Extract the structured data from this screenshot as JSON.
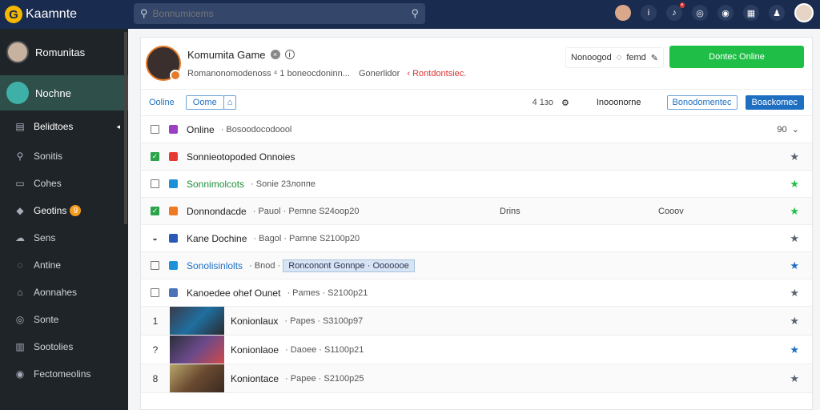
{
  "app": {
    "logo_letter": "G",
    "name": "Kaamnte"
  },
  "search": {
    "placeholder": "Bonnumicems"
  },
  "top_icons": [
    "user-avatar",
    "info-icon",
    "notification-icon",
    "globe-icon",
    "discord-icon",
    "calendar-icon",
    "person-icon",
    "profile-avatar"
  ],
  "sidebar": {
    "user": "Romunitas",
    "active": "Nochne",
    "items": [
      {
        "label": "Belidtoes",
        "icon": "grid-icon",
        "chevron": "◂"
      },
      {
        "label": "Sonitis",
        "icon": "search-icon"
      },
      {
        "label": "Cohes",
        "icon": "library-icon"
      },
      {
        "label": "Geotins",
        "icon": "gamepad-icon",
        "coin": "9"
      },
      {
        "label": "Sens",
        "icon": "cloud-icon"
      },
      {
        "label": "Antine",
        "icon": "chat-icon"
      },
      {
        "label": "Aonnahes",
        "icon": "store-icon"
      },
      {
        "label": "Sonte",
        "icon": "settings-icon"
      },
      {
        "label": "Sootolies",
        "icon": "folder-icon"
      },
      {
        "label": "Fectomeolins",
        "icon": "help-icon"
      }
    ]
  },
  "profile": {
    "title": "Komumita Game",
    "subtitle_a": "Romanonomodenoss ⁴ 1 boneocdoninn...",
    "subtitle_b": "Gonerlidor",
    "subtitle_c": "‹ Rontdontsiec.",
    "status_label": "Nonoogod",
    "status_value": "femd",
    "action_button": "Dontec Online"
  },
  "toolbar": {
    "link": "Ooline",
    "chip": "Oome",
    "count": "4 1зо",
    "label": "Inooonorne",
    "outline_button": "Bonodomentec",
    "blue_button": "Boackomec"
  },
  "colors": {
    "topbar": "#1a2b50",
    "sidebar": "#1f2428",
    "accent_green": "#1fbf47",
    "accent_blue": "#1e6fc2"
  },
  "rows": [
    {
      "name": "Online",
      "meta": "Bosoodocodoool",
      "count": "90",
      "tag_color": "#9b3fc4",
      "check": false
    },
    {
      "name": "Sonnieotopoded Onnoies",
      "meta": "",
      "tag_color": "#e53935",
      "check": true,
      "star": "#5a6272"
    },
    {
      "name": "Sonnimolcots",
      "meta": "Sonie 23лоппе",
      "tag_color": "#1e90d8",
      "check": false,
      "star": "#1fbf47"
    },
    {
      "name": "Donnondacde",
      "meta": "Pauol · Pemne S24oop20",
      "col2": "Drins",
      "col3": "Cooov",
      "tag_color": "#f07a20",
      "check": true,
      "star": "#1fbf47"
    },
    {
      "name": "Kane Dochine",
      "meta": "Bagol · Pamne S2100p20",
      "tag_color": "#2a5ab8",
      "check": false,
      "star": "#5a6272"
    },
    {
      "name": "Sonolisinlolts",
      "meta": "Bnod",
      "highlight": "Ronconont Gonnpe · Ooooooe",
      "tag_color": "#1e90d8",
      "check": false,
      "star": "#1e6fc2"
    },
    {
      "name": "Kanoedee ohef Ounet",
      "meta": "Pames · S2100p21",
      "tag_color": "#4a73b8",
      "check": false,
      "star": "#5a6272"
    },
    {
      "num": "1",
      "name": "Konionlaux",
      "meta": "Papes · S3100p97",
      "star": "#5a6272"
    },
    {
      "num": "?",
      "name": "Konionlaoe",
      "meta": "Daoee · S1100p21",
      "star": "#1e6fc2"
    },
    {
      "num": "8",
      "name": "Koniontace",
      "meta": "Papee · S2100p25",
      "star": "#5a6272"
    }
  ]
}
